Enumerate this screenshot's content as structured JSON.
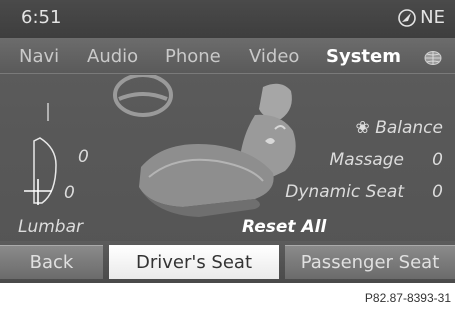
{
  "status": {
    "time": "6:51",
    "heading": "NE"
  },
  "menu": {
    "items": [
      {
        "label": "Navi"
      },
      {
        "label": "Audio"
      },
      {
        "label": "Phone"
      },
      {
        "label": "Video"
      },
      {
        "label": "System",
        "active": true
      }
    ]
  },
  "seat": {
    "lumbar_vertical_value": "0",
    "lumbar_horizontal_value": "0",
    "lumbar_label": "Lumbar",
    "balance_label": "Balance",
    "massage_label": "Massage",
    "massage_value": "0",
    "dynamic_seat_label": "Dynamic Seat",
    "dynamic_seat_value": "0",
    "reset_all_label": "Reset All"
  },
  "bottom": {
    "back_label": "Back",
    "drivers_seat_label": "Driver's Seat",
    "passenger_seat_label": "Passenger Seat"
  },
  "caption": "P82.87-8393-31",
  "colors": {
    "screen_bg": "#595959",
    "text_primary": "#ffffff",
    "text_secondary": "#dcdcdc",
    "selected_button": "#ffffff"
  }
}
